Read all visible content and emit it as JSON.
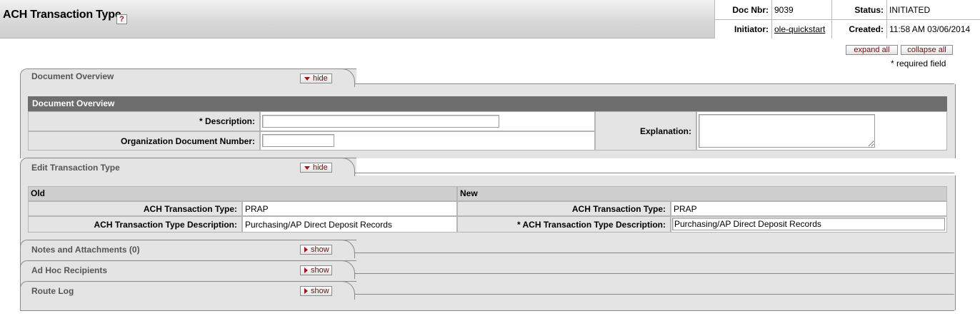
{
  "header": {
    "title": "ACH Transaction Type",
    "help_icon": "?",
    "doc_nbr_label": "Doc Nbr:",
    "doc_nbr": "9039",
    "status_label": "Status:",
    "status": "INITIATED",
    "initiator_label": "Initiator:",
    "initiator": "ole-quickstart",
    "created_label": "Created:",
    "created": "11:58 AM 03/06/2014"
  },
  "toolbar": {
    "expand_all": "expand all",
    "collapse_all": "collapse all",
    "required_note": "* required field"
  },
  "document_overview": {
    "tab_title": "Document Overview",
    "toggle": "hide",
    "section_header": "Document Overview",
    "description_label": "*  Description:",
    "description_value": "",
    "org_doc_number_label": "Organization Document Number:",
    "org_doc_number_value": "",
    "explanation_label": "Explanation:",
    "explanation_value": ""
  },
  "edit_transaction_type": {
    "tab_title": "Edit Transaction Type",
    "toggle": "hide",
    "old_header": "Old",
    "new_header": "New",
    "old": {
      "type_label": "ACH Transaction Type:",
      "type_value": "PRAP",
      "desc_label": "ACH Transaction Type Description:",
      "desc_value": "Purchasing/AP Direct Deposit Records"
    },
    "new": {
      "type_label": "ACH Transaction Type:",
      "type_value": "PRAP",
      "desc_label": "*  ACH Transaction Type Description:",
      "desc_value": "Purchasing/AP Direct Deposit Records"
    }
  },
  "collapsed_tabs": [
    {
      "title": "Notes and Attachments (0)",
      "toggle": "show"
    },
    {
      "title": "Ad Hoc Recipients",
      "toggle": "show"
    },
    {
      "title": "Route Log",
      "toggle": "show"
    }
  ],
  "icons": {
    "help": "question-mark-icon",
    "toggle_hide": "triangle-down-icon",
    "toggle_show": "triangle-right-icon"
  },
  "colors": {
    "section_header_bg": "#6e6e6e",
    "tab_bg": "#e4e4e4",
    "button_text": "#6b0f0f"
  }
}
